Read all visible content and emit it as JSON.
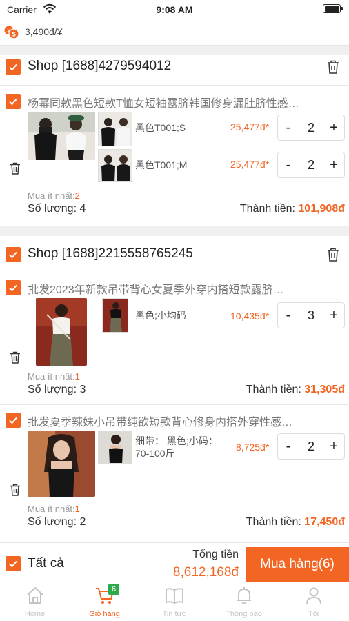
{
  "status_bar": {
    "carrier": "Carrier",
    "time": "9:08 AM"
  },
  "exchange": {
    "rate": "3,490đ/¥"
  },
  "colors": {
    "accent": "#f26522",
    "badge": "#2eaa4c"
  },
  "shops": [
    {
      "name": "Shop [1688]4279594012",
      "products": [
        {
          "title": "杨幂同款黑色短款T恤女短袖露脐韩国修身漏肚脐性感…",
          "variants": [
            {
              "name": "黑色T001;S",
              "price": "25,477đ*",
              "quantity": "2"
            },
            {
              "name": "黑色T001;M",
              "price": "25,477đ*",
              "quantity": "2"
            }
          ],
          "min_label": "Mua ít nhất:",
          "min_value": "2",
          "qty_label": "Số lượng: 4",
          "total_label": "Thành tiền:",
          "total_value": "101,908đ"
        }
      ]
    },
    {
      "name": "Shop [1688]2215558765245",
      "products": [
        {
          "title": "批发2023年新款吊带背心女夏季外穿内搭短款露脐…",
          "variants": [
            {
              "name": "黑色;小均码",
              "price": "10,435đ*",
              "quantity": "3"
            }
          ],
          "min_label": "Mua ít nhất:",
          "min_value": "1",
          "qty_label": "Số lượng: 3",
          "total_label": "Thành tiền:",
          "total_value": "31,305đ"
        },
        {
          "title": "批发夏季辣妹小吊带纯欲短款背心修身内搭外穿性感…",
          "variants": [
            {
              "name_line1": "细带： 黑色;小码：",
              "name_line2": "70-100斤",
              "price": "8,725đ*",
              "quantity": "2"
            }
          ],
          "min_label": "Mua ít nhất:",
          "min_value": "1",
          "qty_label": "Số lượng: 2",
          "total_label": "Thành tiền:",
          "total_value": "17,450đ"
        }
      ]
    }
  ],
  "footer": {
    "select_all": "Tất cả",
    "total_title": "Tổng tiền",
    "total_amount": "8,612,168đ",
    "buy_button": "Mua hàng(6)"
  },
  "tabs": [
    {
      "label": "Home",
      "icon": "home-icon"
    },
    {
      "label": "Giỏ hàng",
      "icon": "cart-icon",
      "badge": "6",
      "active": true
    },
    {
      "label": "Tin tức",
      "icon": "book-icon"
    },
    {
      "label": "Thông báo",
      "icon": "bell-icon"
    },
    {
      "label": "Tôi",
      "icon": "user-icon"
    }
  ],
  "icons": {
    "minus": "-",
    "plus": "+"
  }
}
